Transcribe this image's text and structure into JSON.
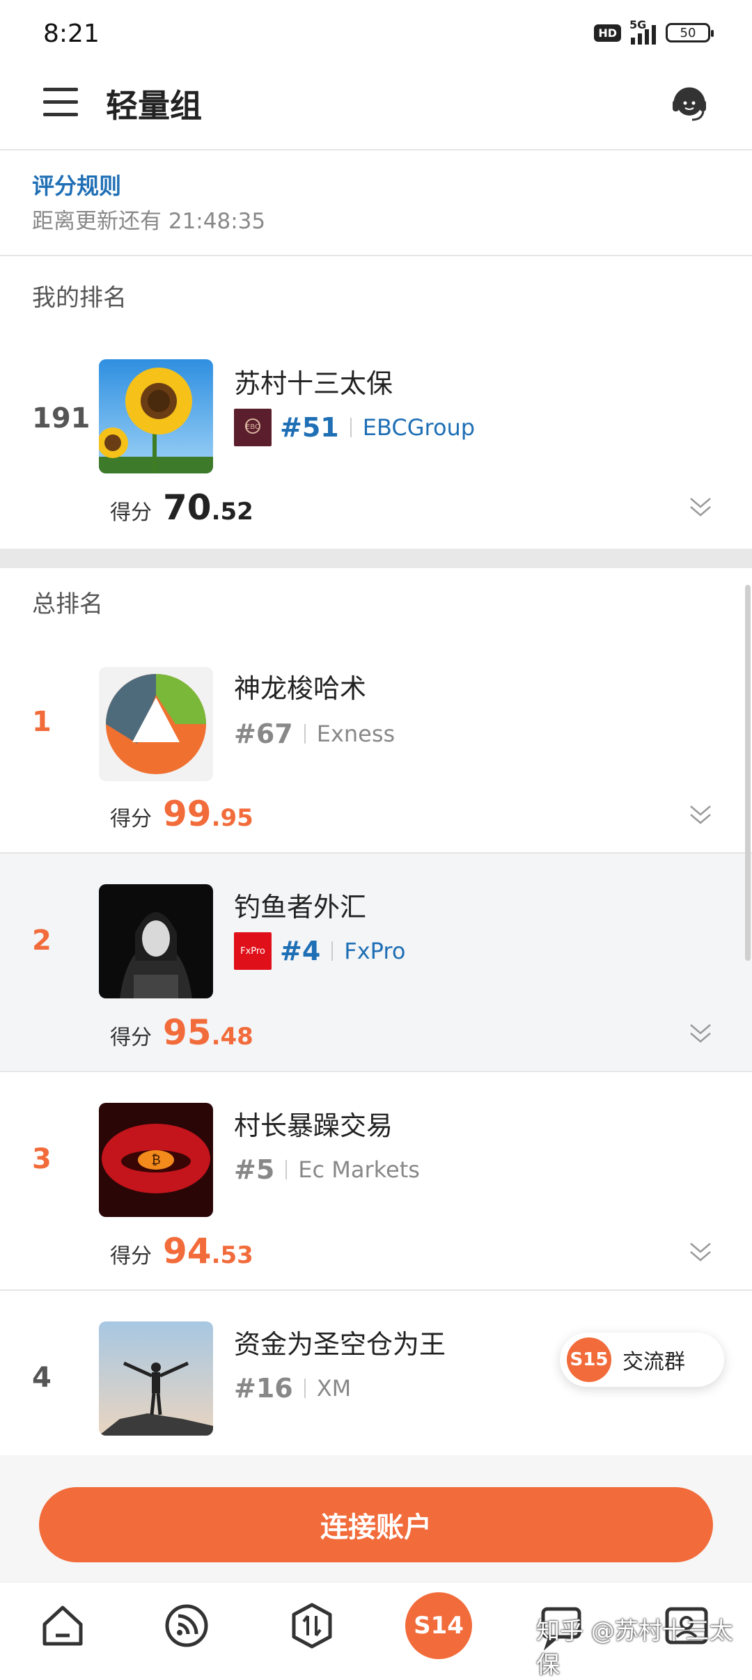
{
  "status": {
    "time": "8:21",
    "hd": "HD",
    "network": "5G",
    "battery": "50"
  },
  "header": {
    "title": "轻量组"
  },
  "rules": {
    "link": "评分规则",
    "countdown": "距离更新还有 21:48:35"
  },
  "my_rank": {
    "section_label": "我的排名",
    "rank": "191",
    "name": "苏村十三太保",
    "broker_rank": "#51",
    "broker": "EBCGroup",
    "score_label": "得分",
    "score_int": "70",
    "score_dec": ".52"
  },
  "overall": {
    "section_label": "总排名",
    "items": [
      {
        "rank": "1",
        "name": "神龙梭哈术",
        "broker_rank": "#67",
        "broker": "Exness",
        "score_label": "得分",
        "score_int": "99",
        "score_dec": ".95"
      },
      {
        "rank": "2",
        "name": "钓鱼者外汇",
        "broker_rank": "#4",
        "broker": "FxPro",
        "broker_logo_text": "FxPro",
        "score_label": "得分",
        "score_int": "95",
        "score_dec": ".48"
      },
      {
        "rank": "3",
        "name": "村长暴躁交易",
        "broker_rank": "#5",
        "broker": "Ec Markets",
        "score_label": "得分",
        "score_int": "94",
        "score_dec": ".53"
      },
      {
        "rank": "4",
        "name": "资金为圣空仓为王",
        "broker_rank": "#16",
        "broker": "XM"
      }
    ]
  },
  "float_group": {
    "badge": "S15",
    "label": "交流群"
  },
  "connect_button": "连接账户",
  "tabbar": {
    "center_badge": "S14",
    "watermark": "知乎 @苏村十三太保"
  },
  "colors": {
    "accent": "#f26b3a",
    "link": "#1f6fb5",
    "muted": "#888888"
  }
}
